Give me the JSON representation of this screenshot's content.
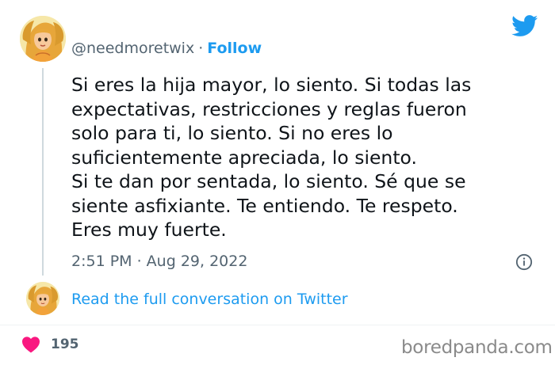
{
  "tweet": {
    "author": {
      "handle": "@needmoretwix",
      "separator": "·",
      "follow_label": "Follow",
      "avatar_icon": "cartoon-fairy-avatar-icon"
    },
    "brand": {
      "icon": "twitter-bird-icon",
      "color": "#1d9bf0"
    },
    "text_lines": [
      "Si eres la hija mayor, lo siento. Si todas las",
      "expectativas, restricciones y reglas fueron",
      "solo para ti, lo siento. Si no eres lo",
      "suficientemente apreciada, lo siento.",
      "Si te dan por sentada, lo siento. Sé que se",
      "siente asfixiante. Te entiendo. Te respeto.",
      "Eres muy fuerte."
    ],
    "timestamp": "2:51 PM · Aug 29, 2022",
    "info_icon": "info-icon",
    "read_conversation_label": "Read the full conversation on Twitter",
    "likes": {
      "icon": "heart-icon",
      "count": "195",
      "color": "#f91880"
    }
  },
  "watermark": {
    "text": "boredpanda.com"
  }
}
